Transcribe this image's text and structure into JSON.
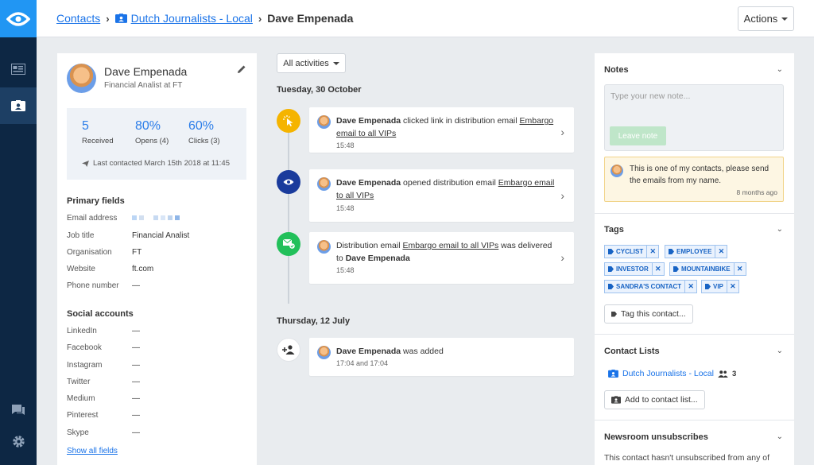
{
  "breadcrumb": {
    "root": "Contacts",
    "list": "Dutch Journalists - Local",
    "current": "Dave Empenada"
  },
  "header": {
    "actions_label": "Actions"
  },
  "profile": {
    "name": "Dave Empenada",
    "subtitle": "Financial Analist at FT",
    "stats": [
      {
        "value": "5",
        "label": "Received"
      },
      {
        "value": "80%",
        "label": "Opens (4)"
      },
      {
        "value": "60%",
        "label": "Clicks (3)"
      }
    ],
    "last_contacted": "Last contacted March 15th 2018 at 11:45"
  },
  "primary_fields": {
    "title": "Primary fields",
    "rows": [
      {
        "label": "Email address",
        "value": ""
      },
      {
        "label": "Job title",
        "value": "Financial Analist"
      },
      {
        "label": "Organisation",
        "value": "FT"
      },
      {
        "label": "Website",
        "value": "ft.com"
      },
      {
        "label": "Phone number",
        "value": "—"
      }
    ]
  },
  "social_accounts": {
    "title": "Social accounts",
    "rows": [
      {
        "label": "LinkedIn",
        "value": "—"
      },
      {
        "label": "Facebook",
        "value": "—"
      },
      {
        "label": "Instagram",
        "value": "—"
      },
      {
        "label": "Twitter",
        "value": "—"
      },
      {
        "label": "Medium",
        "value": "—"
      },
      {
        "label": "Pinterest",
        "value": "—"
      },
      {
        "label": "Skype",
        "value": "—"
      }
    ],
    "show_all": "Show all fields"
  },
  "timeline": {
    "filter_label": "All activities",
    "groups": [
      {
        "date": "Tuesday, 30 October",
        "items": [
          {
            "pre": "Dave Empenada",
            "mid": " clicked link in distribution email ",
            "link": "Embargo email to all VIPs",
            "post": "",
            "tail": "",
            "time": "15:48"
          },
          {
            "pre": "Dave Empenada",
            "mid": " opened distribution email ",
            "link": "Embargo email to all VIPs",
            "post": "",
            "tail": "",
            "time": "15:48"
          },
          {
            "pre": "",
            "mid": "Distribution email ",
            "link": "Embargo email to all VIPs",
            "post": " was delivered to ",
            "tail": "Dave Empenada",
            "time": "15:48"
          }
        ]
      },
      {
        "date": "Thursday, 12 July",
        "items": [
          {
            "pre": "Dave Empenada",
            "mid": " was added",
            "link": "",
            "post": "",
            "tail": "",
            "time": "17:04 and 17:04"
          }
        ]
      }
    ]
  },
  "notes": {
    "title": "Notes",
    "placeholder": "Type your new note...",
    "leave_label": "Leave note",
    "note_text": "This is one of my contacts, please send the emails from my name.",
    "note_age": "8 months ago"
  },
  "tags": {
    "title": "Tags",
    "items": [
      "CYCLIST",
      "EMPLOYEE",
      "INVESTOR",
      "MOUNTAINBIKE",
      "SANDRA'S CONTACT",
      "VIP"
    ],
    "tag_button": "Tag this contact..."
  },
  "contact_lists": {
    "title": "Contact Lists",
    "list_name": "Dutch Journalists - Local",
    "member_count": "3",
    "add_button": "Add to contact list..."
  },
  "unsubscribes": {
    "title": "Newsroom unsubscribes",
    "text": "This contact hasn't unsubscribed from any of"
  },
  "colors": {
    "sidebar": "#0d2744",
    "brand": "#2196f3",
    "link": "#1a73e8",
    "click_icon": "#f5b400",
    "open_icon": "#1a3b9c",
    "delivered_icon": "#22c05a"
  }
}
